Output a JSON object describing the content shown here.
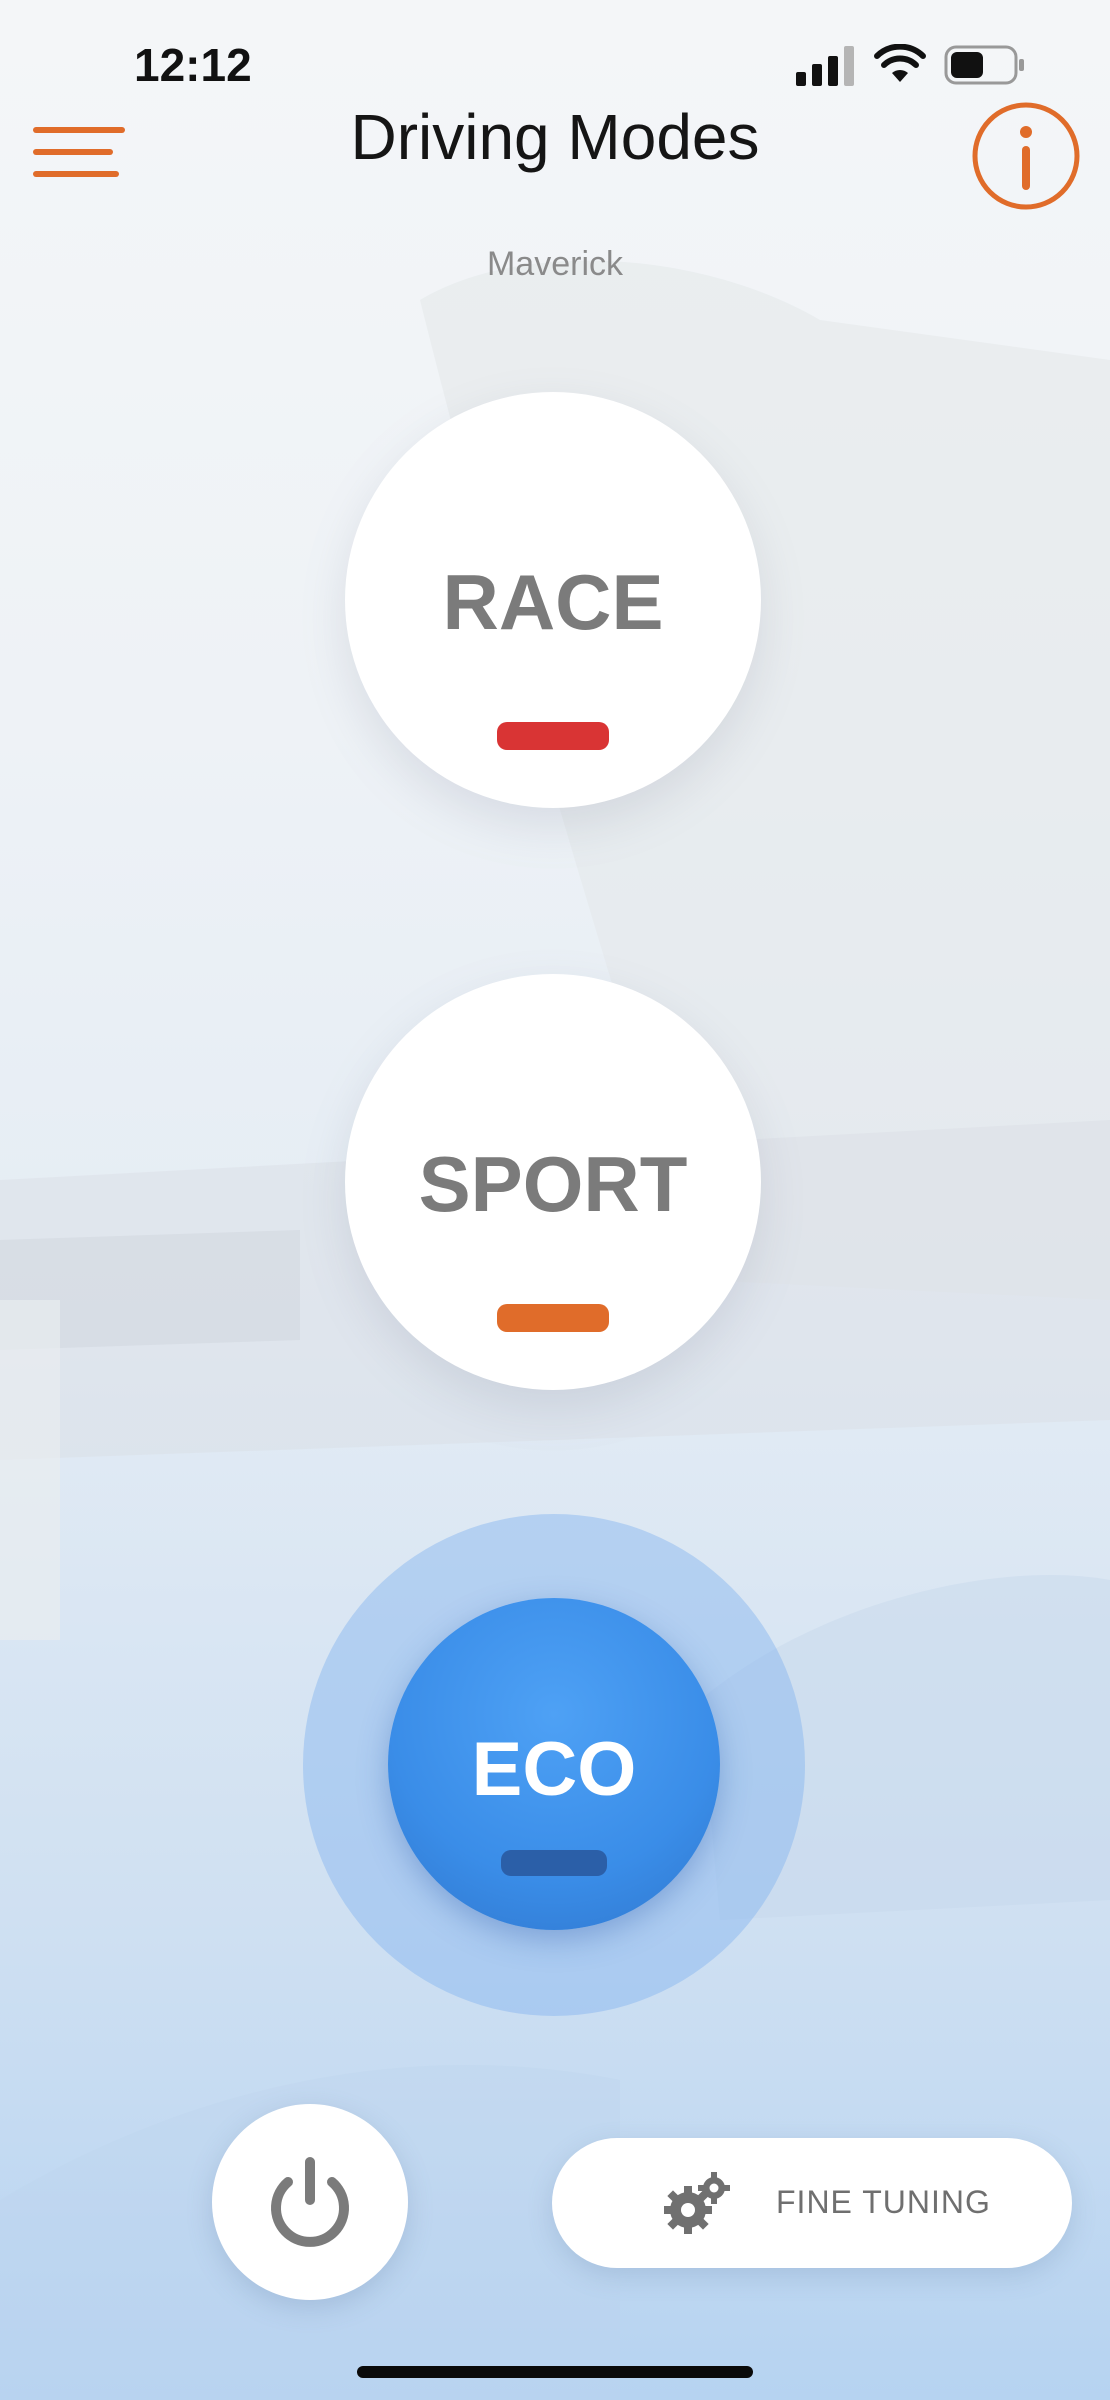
{
  "status_bar": {
    "time": "12:12"
  },
  "header": {
    "title": "Driving Modes",
    "menu_icon": "hamburger-menu-icon",
    "info_icon": "info-icon"
  },
  "car": {
    "name": "Maverick"
  },
  "modes": [
    {
      "label": "RACE",
      "indicator_color": "#d93434"
    },
    {
      "label": "SPORT",
      "indicator_color": "#e06c2a"
    },
    {
      "label": "ECO",
      "indicator_color": "#2b5fa8",
      "selected": true
    }
  ],
  "bottom_bar": {
    "power_icon": "power-icon",
    "fine_tuning_label": "FINE TUNING",
    "fine_tuning_icon": "gear-icon"
  },
  "colors": {
    "accent": "#e06c2a",
    "eco_active": "#3a8de8"
  }
}
